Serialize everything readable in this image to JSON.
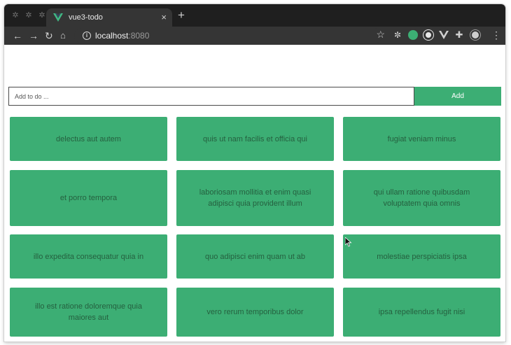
{
  "browser": {
    "tab_title": "vue3-todo",
    "close_glyph": "×",
    "new_tab_glyph": "+",
    "url_host": "localhost",
    "url_port": ":8080"
  },
  "form": {
    "placeholder": "Add to do ...",
    "add_label": "Add"
  },
  "todos": [
    "delectus aut autem",
    "quis ut nam facilis et officia qui",
    "fugiat veniam minus",
    "et porro tempora",
    "laboriosam mollitia et enim quasi adipisci quia provident illum",
    "qui ullam ratione quibusdam voluptatem quia omnis",
    "illo expedita consequatur quia in",
    "quo adipisci enim quam ut ab",
    "molestiae perspiciatis ipsa",
    "illo est ratione doloremque quia maiores aut",
    "vero rerum temporibus dolor",
    "ipsa repellendus fugit nisi"
  ],
  "colors": {
    "accent": "#3cae74",
    "card_text": "#25603f",
    "chrome_dark": "#1f1f1f",
    "chrome_toolbar": "#353535"
  }
}
